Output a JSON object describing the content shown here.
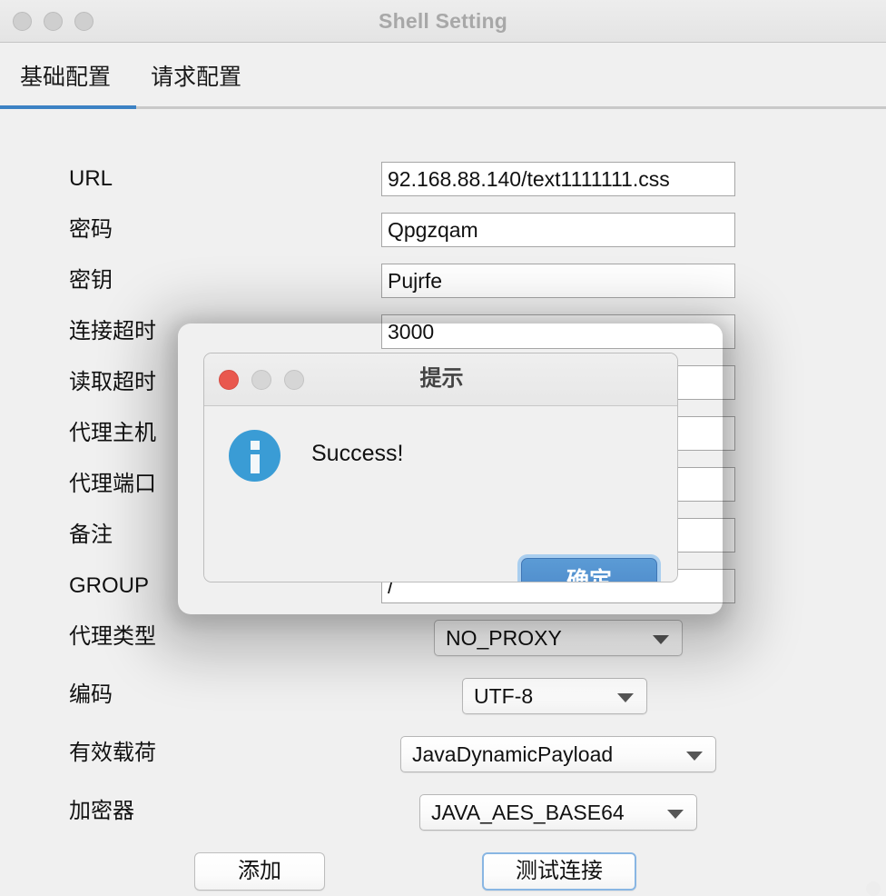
{
  "window": {
    "title": "Shell Setting",
    "traffic_lights": [
      "close-button",
      "minimize-button",
      "maximize-button"
    ]
  },
  "tabs": [
    {
      "label": "基础配置",
      "active": true
    },
    {
      "label": "请求配置",
      "active": false
    }
  ],
  "form": {
    "rows": [
      {
        "label": "URL",
        "type": "text",
        "value": "92.168.88.140/text1111111.css"
      },
      {
        "label": "密码",
        "type": "text",
        "value": "Qpgzqam"
      },
      {
        "label": "密钥",
        "type": "text",
        "value": "Pujrfe"
      },
      {
        "label": "连接超时",
        "type": "text",
        "value": "3000"
      },
      {
        "label": "读取超时",
        "type": "text",
        "value": ""
      },
      {
        "label": "代理主机",
        "type": "text",
        "value": ""
      },
      {
        "label": "代理端口",
        "type": "text",
        "value": ""
      },
      {
        "label": "备注",
        "type": "text",
        "value": ""
      },
      {
        "label": "GROUP",
        "type": "text",
        "value": "/"
      },
      {
        "label": "代理类型",
        "type": "combo",
        "value": "NO_PROXY"
      },
      {
        "label": "编码",
        "type": "combo",
        "value": "UTF-8"
      },
      {
        "label": "有效载荷",
        "type": "combo",
        "value": "JavaDynamicPayload"
      },
      {
        "label": "加密器",
        "type": "combo",
        "value": "JAVA_AES_BASE64"
      }
    ]
  },
  "buttons": {
    "add": "添加",
    "test_connection": "测试连接"
  },
  "dialog": {
    "title": "提示",
    "message": "Success!",
    "ok_label": "确定",
    "icon": "info-icon",
    "traffic_lights": [
      "close-button",
      "minimize-button",
      "maximize-button"
    ]
  },
  "colors": {
    "accent": "#3c82c4",
    "dialog_button": "#4a86c8",
    "info_icon": "#3a9cd5",
    "close_button": "#e9584e",
    "window_bg": "#f0f0f0"
  }
}
